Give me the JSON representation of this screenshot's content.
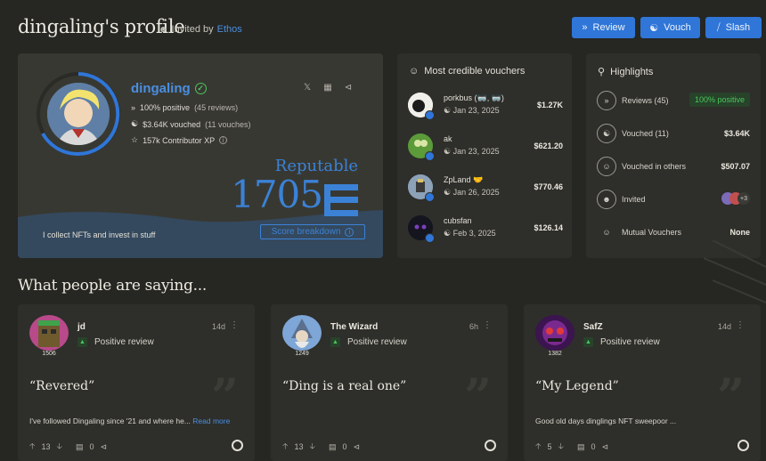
{
  "header": {
    "title": "dingaling's profile",
    "invited_prefix": "Invited by",
    "invited_by": "Ethos",
    "buttons": {
      "review": "Review",
      "vouch": "Vouch",
      "slash": "Slash"
    }
  },
  "profile": {
    "name": "dingaling",
    "positive": "100% positive",
    "reviews": "(45 reviews)",
    "vouched": "$3.64K vouched",
    "vouches": "(11 vouches)",
    "xp": "157k Contributor XP",
    "status": "Reputable",
    "score": "1705",
    "score_button": "Score breakdown",
    "bio": "I collect NFTs and invest in stuff"
  },
  "vouchers": {
    "title": "Most credible vouchers",
    "items": [
      {
        "name": "porkbus (🥽, 🥽)",
        "date": "Jan 23, 2025",
        "amount": "$1.27K"
      },
      {
        "name": "ak",
        "date": "Jan 23, 2025",
        "amount": "$621.20"
      },
      {
        "name": "ZpLand 🤝",
        "date": "Jan 26, 2025",
        "amount": "$770.46"
      },
      {
        "name": "cubsfan",
        "date": "Feb 3, 2025",
        "amount": "$126.14"
      }
    ]
  },
  "highlights": {
    "title": "Highlights",
    "reviews_label": "Reviews (45)",
    "reviews_badge": "100% positive",
    "vouched_label": "Vouched (11)",
    "vouched_value": "$3.64K",
    "vouched_others_label": "Vouched in others",
    "vouched_others_value": "$507.07",
    "invited_label": "Invited",
    "invited_more": "+3",
    "mutual_label": "Mutual Vouchers",
    "mutual_value": "None"
  },
  "reviews": {
    "title": "What people are saying...",
    "items": [
      {
        "author": "jd",
        "score": "1506",
        "time": "14d",
        "sentiment": "Positive review",
        "quote": "“Revered”",
        "text": "I've followed Dingaling since '21 and where he...",
        "more": "Read more",
        "up": "13",
        "comments": "0"
      },
      {
        "author": "The Wizard",
        "score": "1249",
        "time": "6h",
        "sentiment": "Positive review",
        "quote": "“Ding is a real one”",
        "text": "",
        "more": "",
        "up": "13",
        "comments": "0"
      },
      {
        "author": "SafZ",
        "score": "1382",
        "time": "14d",
        "sentiment": "Positive review",
        "quote": "“My Legend”",
        "text": "Good old days dinglings NFT sweepoor ...",
        "more": "",
        "up": "5",
        "comments": "0"
      }
    ]
  },
  "colors": {
    "accent": "#2f76d8",
    "score": "#3b82d6",
    "positive": "#4dc45d",
    "background": "#262622"
  }
}
